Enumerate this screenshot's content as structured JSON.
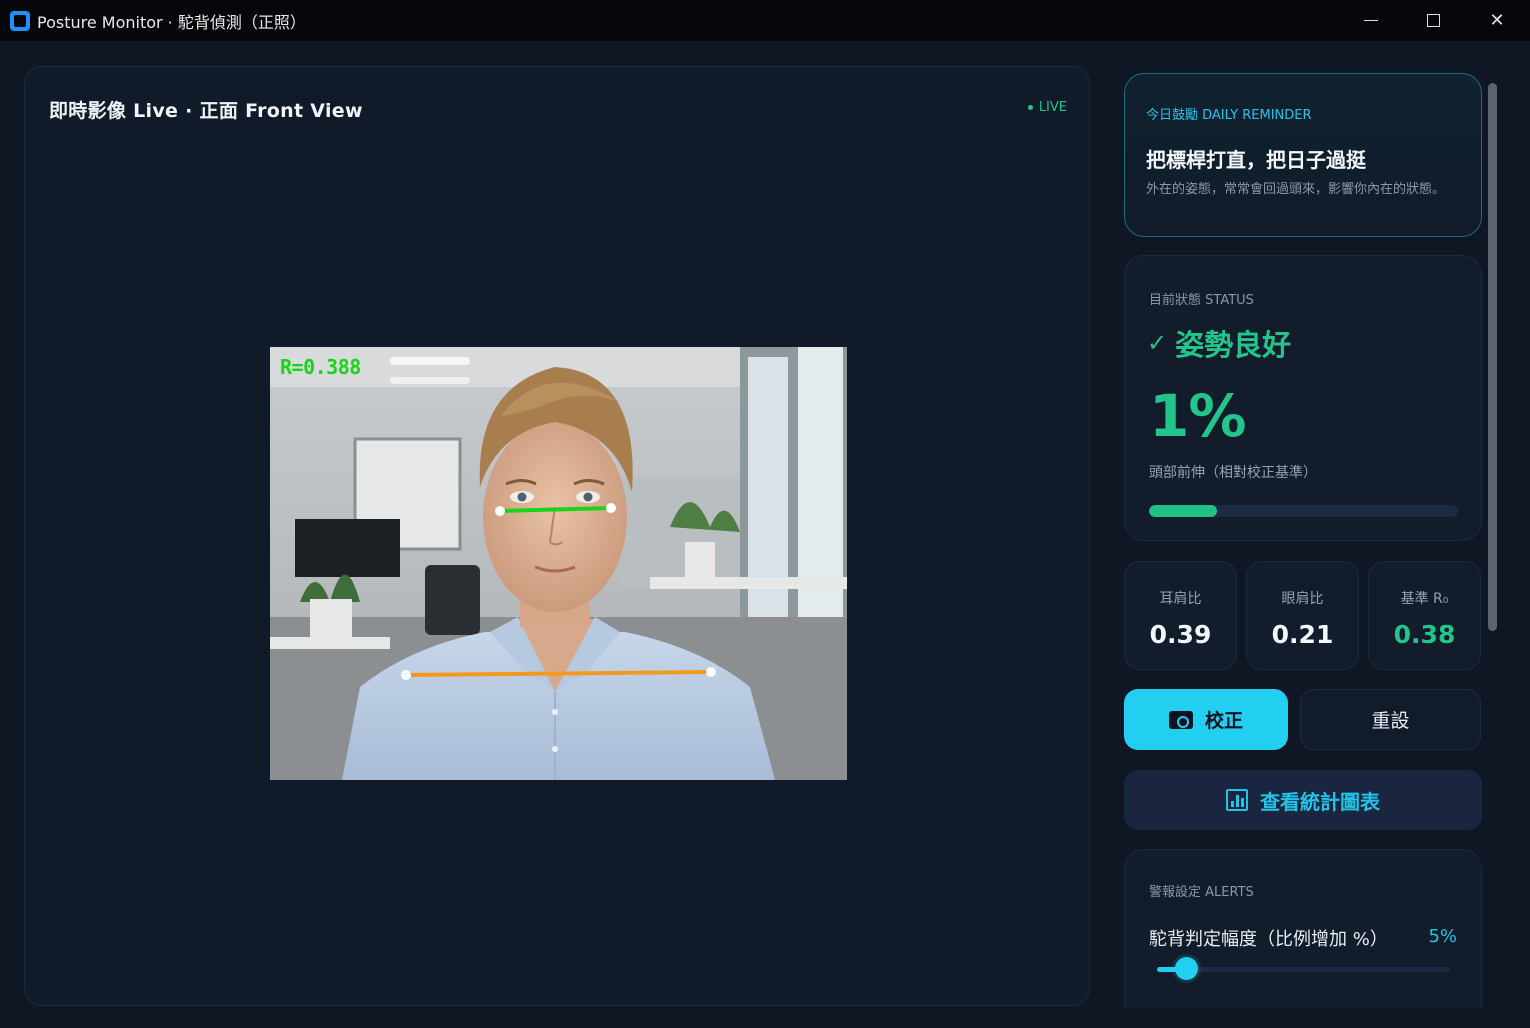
{
  "window": {
    "title": "Posture Monitor · 駝背偵測（正照）"
  },
  "video": {
    "title": "即時影像  Live · 正面 Front View",
    "live_label": "LIVE",
    "ratio_overlay": "R=0.388"
  },
  "reminder": {
    "heading": "今日鼓勵  DAILY REMINDER",
    "title": "把標桿打直，把日子過挺",
    "body": "外在的姿態，常常會回過頭來，影響你內在的狀態。"
  },
  "status": {
    "heading": "目前狀態  STATUS",
    "check_icon": "✓",
    "state": "姿勢良好",
    "percent": "1%",
    "description": "頭部前伸（相對校正基準）",
    "progress_fraction": 0.22
  },
  "metrics": [
    {
      "label": "耳肩比",
      "value": "0.39"
    },
    {
      "label": "眼肩比",
      "value": "0.21"
    },
    {
      "label": "基準 R₀",
      "value": "0.38"
    }
  ],
  "actions": {
    "calibrate": "校正",
    "reset": "重設",
    "stats": "查看統計圖表"
  },
  "alerts": {
    "heading": "警報設定  ALERTS",
    "threshold_label": "駝背判定幅度（比例增加 %）",
    "threshold_value": "5%",
    "slider_fraction": 0.1
  },
  "colors": {
    "accent_green": "#22c58b",
    "accent_cyan": "#22cff0",
    "eye_line": "#19d419",
    "shoulder_line": "#f39a1e"
  }
}
